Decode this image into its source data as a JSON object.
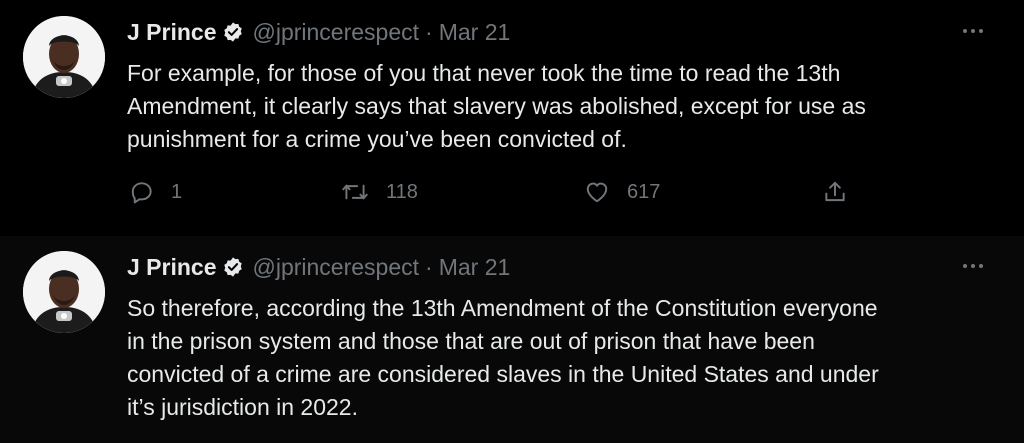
{
  "tweets": [
    {
      "name": "J Prince",
      "handle": "@jprincerespect",
      "separator": "·",
      "date": "Mar 21",
      "lines": [
        "For example, for those of you that never took the time to read the 13th",
        "Amendment, it clearly says that slavery was abolished, except for use as",
        "punishment for a crime you’ve been convicted of."
      ],
      "replies": "1",
      "retweets": "118",
      "likes": "617"
    },
    {
      "name": "J Prince",
      "handle": "@jprincerespect",
      "separator": "·",
      "date": "Mar 21",
      "lines": [
        "So therefore, according the 13th Amendment of the Constitution everyone",
        "in the prison system and those that are out of prison that have been",
        "convicted of a crime are considered slaves in the United States and under",
        "it’s jurisdiction in 2022."
      ]
    }
  ],
  "icons": {
    "reply": "reply-icon",
    "retweet": "retweet-icon",
    "like": "heart-icon",
    "share": "share-icon",
    "verified": "verified-badge-icon",
    "more": "more-icon"
  },
  "colors": {
    "background": "#000000",
    "text": "#e7e9ea",
    "muted": "#71767b",
    "thread_line": "#333639"
  }
}
